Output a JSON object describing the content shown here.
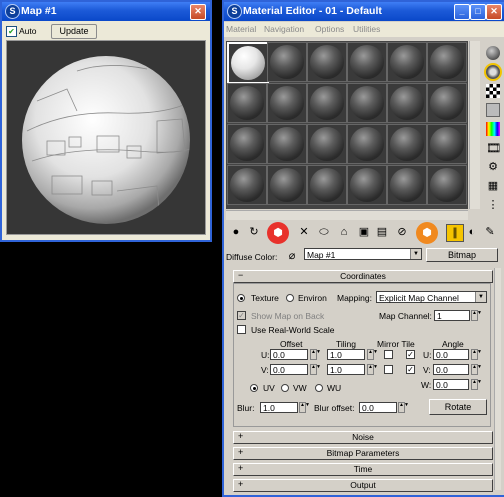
{
  "map_window": {
    "title": "Map #1",
    "auto_label": "Auto",
    "auto_checked": true,
    "update_label": "Update"
  },
  "material_editor": {
    "title": "Material Editor - 01 - Default",
    "menu": [
      "Material",
      "Navigation",
      "Options",
      "Utilities"
    ],
    "slot_grid": {
      "rows": 4,
      "cols": 6
    },
    "diffuse_label": "Diffuse Color:",
    "map_name": "Map #1",
    "map_type_button": "Bitmap",
    "rollouts": {
      "coordinates": "Coordinates",
      "noise": "Noise",
      "bitmap_params": "Bitmap Parameters",
      "time": "Time",
      "output": "Output"
    },
    "coordinates": {
      "texture_label": "Texture",
      "environ_label": "Environ",
      "mapping_label": "Mapping:",
      "mapping_value": "Explicit Map Channel",
      "show_map_on_back": "Show Map on Back",
      "map_channel_label": "Map Channel:",
      "map_channel_value": "1",
      "use_real_world": "Use Real-World Scale",
      "offset_label": "Offset",
      "tiling_label": "Tiling",
      "mirror_tile_label": "Mirror Tile",
      "angle_label": "Angle",
      "u_label": "U:",
      "v_label": "V:",
      "w_label": "W:",
      "u_offset": "0.0",
      "v_offset": "0.0",
      "u_tiling": "1.0",
      "v_tiling": "1.0",
      "u_angle": "0.0",
      "v_angle": "0.0",
      "w_angle": "0.0",
      "uv_label": "UV",
      "vw_label": "VW",
      "wu_label": "WU",
      "blur_label": "Blur:",
      "blur_value": "1.0",
      "blur_offset_label": "Blur offset:",
      "blur_offset_value": "0.0",
      "rotate_label": "Rotate"
    }
  },
  "colors": {
    "title_blue": "#1c5ad8",
    "highlight_red": "#e8312b",
    "highlight_orange": "#f0891f",
    "panel": "#d4d0c8"
  }
}
